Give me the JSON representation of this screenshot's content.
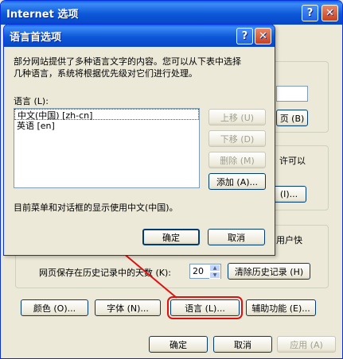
{
  "outer_window": {
    "title": "Internet 选项",
    "help_glyph": "?",
    "close_glyph": "✕",
    "history": {
      "days_label": "网页保存在历史记录中的天数 (K):",
      "days_value": "20",
      "clear_button": "清除历史记录 (H)"
    },
    "partial_texts": {
      "page_button": "页 (B)",
      "can_text": "许可以",
      "user_text": "用户快",
      "dots_button": "(I)..."
    },
    "bottom_buttons": {
      "colors": "颜色 (O)...",
      "fonts": "字体 (N)...",
      "languages": "语言 (L)...",
      "accessibility": "辅助功能 (E)..."
    },
    "dialog_buttons": {
      "ok": "确定",
      "cancel": "取消",
      "apply": "应用 (A)"
    }
  },
  "language_dialog": {
    "title": "语言首选项",
    "help_glyph": "?",
    "close_glyph": "✕",
    "description": "部分网站提供了多种语言文字的内容。您可以从下表中选择几种语言，系统将根据优先级对它们进行处理。",
    "description_line1": "部分网站提供了多种语言文字的内容。您可以从下表中选择",
    "description_line2": "几种语言，系统将根据优先级对它们进行处理。",
    "language_label": "语言 (L):",
    "languages": [
      "中文(中国) [zh-cn]",
      "英语 [en]"
    ],
    "buttons": {
      "move_up": "上移 (U)",
      "move_down": "下移 (D)",
      "remove": "删除 (M)",
      "add": "添加 (A)..."
    },
    "menu_language_note": "目前菜单和对话框的显示使用中文(中国)。",
    "ok": "确定",
    "cancel": "取消"
  },
  "colors": {
    "titlebar": "#0a5fe8",
    "annotation_red": "#e01010",
    "window_bg": "#ece9d8"
  }
}
